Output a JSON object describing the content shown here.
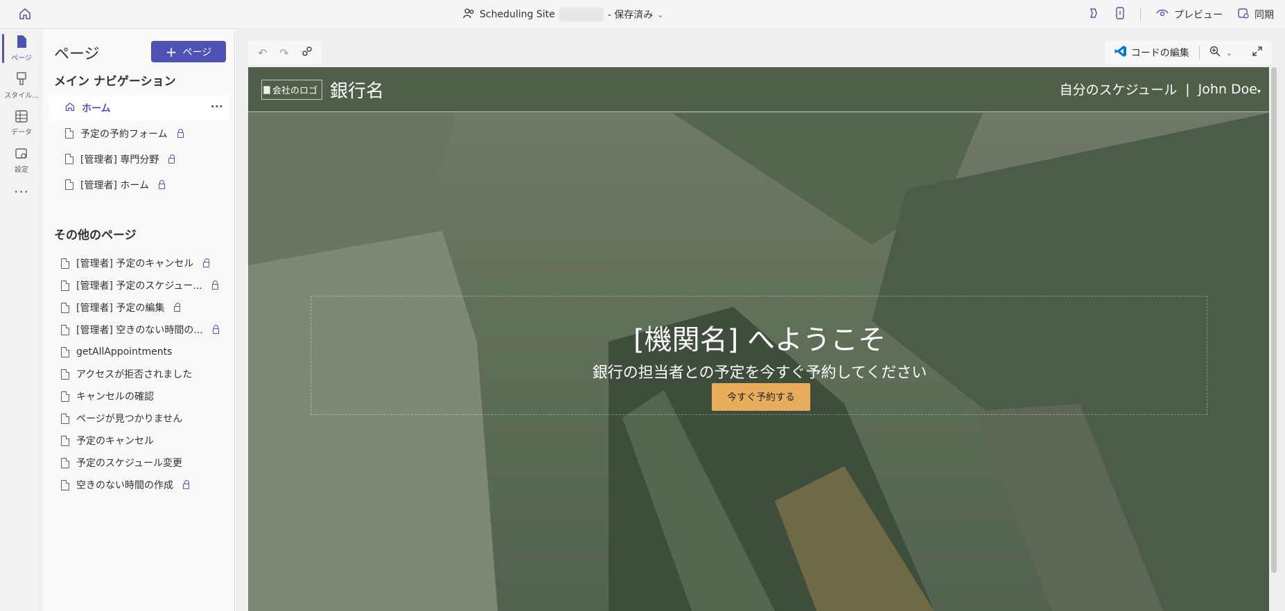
{
  "topbar": {
    "site_name": "Scheduling Site",
    "save_status": "- 保存済み",
    "preview_label": "プレビュー",
    "sync_label": "同期"
  },
  "rail": {
    "items": [
      {
        "label": "ページ",
        "icon": "page-icon"
      },
      {
        "label": "スタイル...",
        "icon": "brush-icon"
      },
      {
        "label": "データ",
        "icon": "table-icon"
      },
      {
        "label": "設定",
        "icon": "settings-icon"
      }
    ],
    "more": "···"
  },
  "panel": {
    "title": "ページ",
    "add_button": "ページ",
    "main_nav_title": "メイン ナビゲーション",
    "main_nav": [
      {
        "label": "ホーム",
        "locked": false
      },
      {
        "label": "予定の予約フォーム",
        "locked": true
      },
      {
        "label": "[管理者] 専門分野",
        "locked": true
      },
      {
        "label": "[管理者] ホーム",
        "locked": true
      }
    ],
    "other_title": "その他のページ",
    "other_pages": [
      {
        "label": "[管理者] 予定のキャンセル",
        "locked": true
      },
      {
        "label": "[管理者] 予定のスケジュー...",
        "locked": true
      },
      {
        "label": "[管理者] 予定の編集",
        "locked": true
      },
      {
        "label": "[管理者] 空きのない時間の...",
        "locked": true
      },
      {
        "label": "getAllAppointments",
        "locked": false
      },
      {
        "label": "アクセスが拒否されました",
        "locked": false
      },
      {
        "label": "キャンセルの確認",
        "locked": false
      },
      {
        "label": "ページが見つかりません",
        "locked": false
      },
      {
        "label": "予定のキャンセル",
        "locked": false
      },
      {
        "label": "予定のスケジュール変更",
        "locked": false
      },
      {
        "label": "空きのない時間の作成",
        "locked": true
      }
    ]
  },
  "editor": {
    "edit_code_label": "コードの編集"
  },
  "site": {
    "logo_alt": "会社のロゴ",
    "bank_name": "銀行名",
    "nav_schedule": "自分のスケジュール",
    "nav_separator": "|",
    "user_name": "John Doe",
    "welcome": "[機関名] へようこそ",
    "subtitle": "銀行の担当者との予定を今すぐ予約してください",
    "cta": "今すぐ予約する"
  },
  "colors": {
    "accent": "#4f52b2",
    "header_bg": "#4f5f4a",
    "cta_bg": "#e7ad5c"
  }
}
